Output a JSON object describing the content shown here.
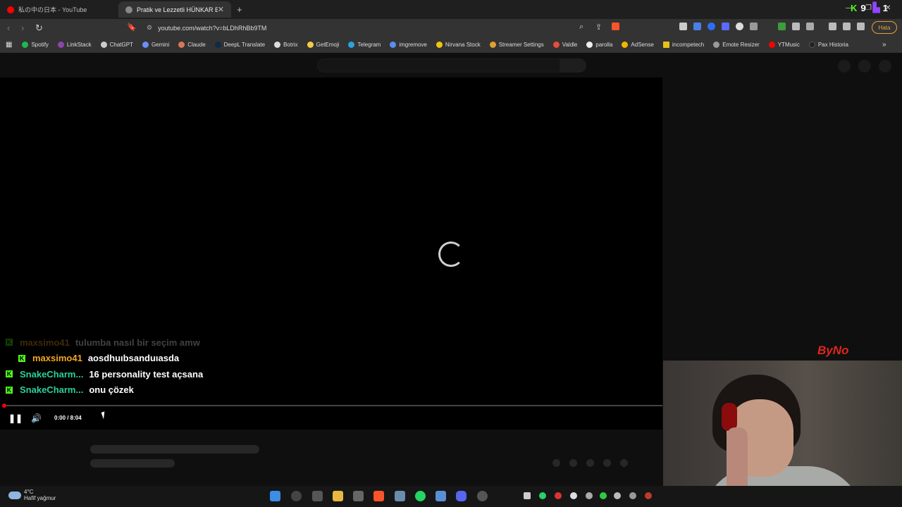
{
  "tabs": [
    {
      "title": "私の中の日本 - YouTube",
      "icon": "youtube-icon",
      "active": false
    },
    {
      "title": "Pratik ve Lezzetli HÜNKAR BEĞE",
      "icon": "globe-icon",
      "active": true
    }
  ],
  "address_bar": {
    "url": "youtube.com/watch?v=bLDhRhBb9TM"
  },
  "toolbar": {
    "error_badge": "Hata"
  },
  "bookmarks": [
    "Spotify",
    "LinkStack",
    "ChatGPT",
    "Gemini",
    "Claude",
    "DeepL Translate",
    "Botrix",
    "GetEmoji",
    "Telegram",
    "imgremove",
    "Nirvana Stock",
    "Streamer Settings",
    "Valdle",
    "parolla",
    "AdSense",
    "incompetech",
    "Emote Resizer",
    "YTMusic",
    "Pax Historia"
  ],
  "chat": [
    {
      "user": "maxsimo41",
      "message": "tulumba nasıl bir seçim amw",
      "faded": true
    },
    {
      "user": "maxsimo41",
      "message": "aosdhuıbsanduıasda",
      "faded": false
    },
    {
      "user": "SnakeCharm...",
      "message": "16 personality test açsana",
      "faded": false
    },
    {
      "user": "SnakeCharm...",
      "message": "onu çözek",
      "faded": false
    }
  ],
  "player": {
    "time": "0:00 / 8:04",
    "progress": 0.0
  },
  "overlay": {
    "logo_text": "ByNo"
  },
  "taskbar": {
    "temperature": "4°C",
    "weather": "Hafif yağmur"
  },
  "stream_counts": {
    "kick": "9",
    "twitch": "1"
  },
  "colors": {
    "kick_green": "#53fc18",
    "twitch_purple": "#9146ff",
    "user_orange": "#f5a623",
    "user_teal": "#2bd19d"
  }
}
